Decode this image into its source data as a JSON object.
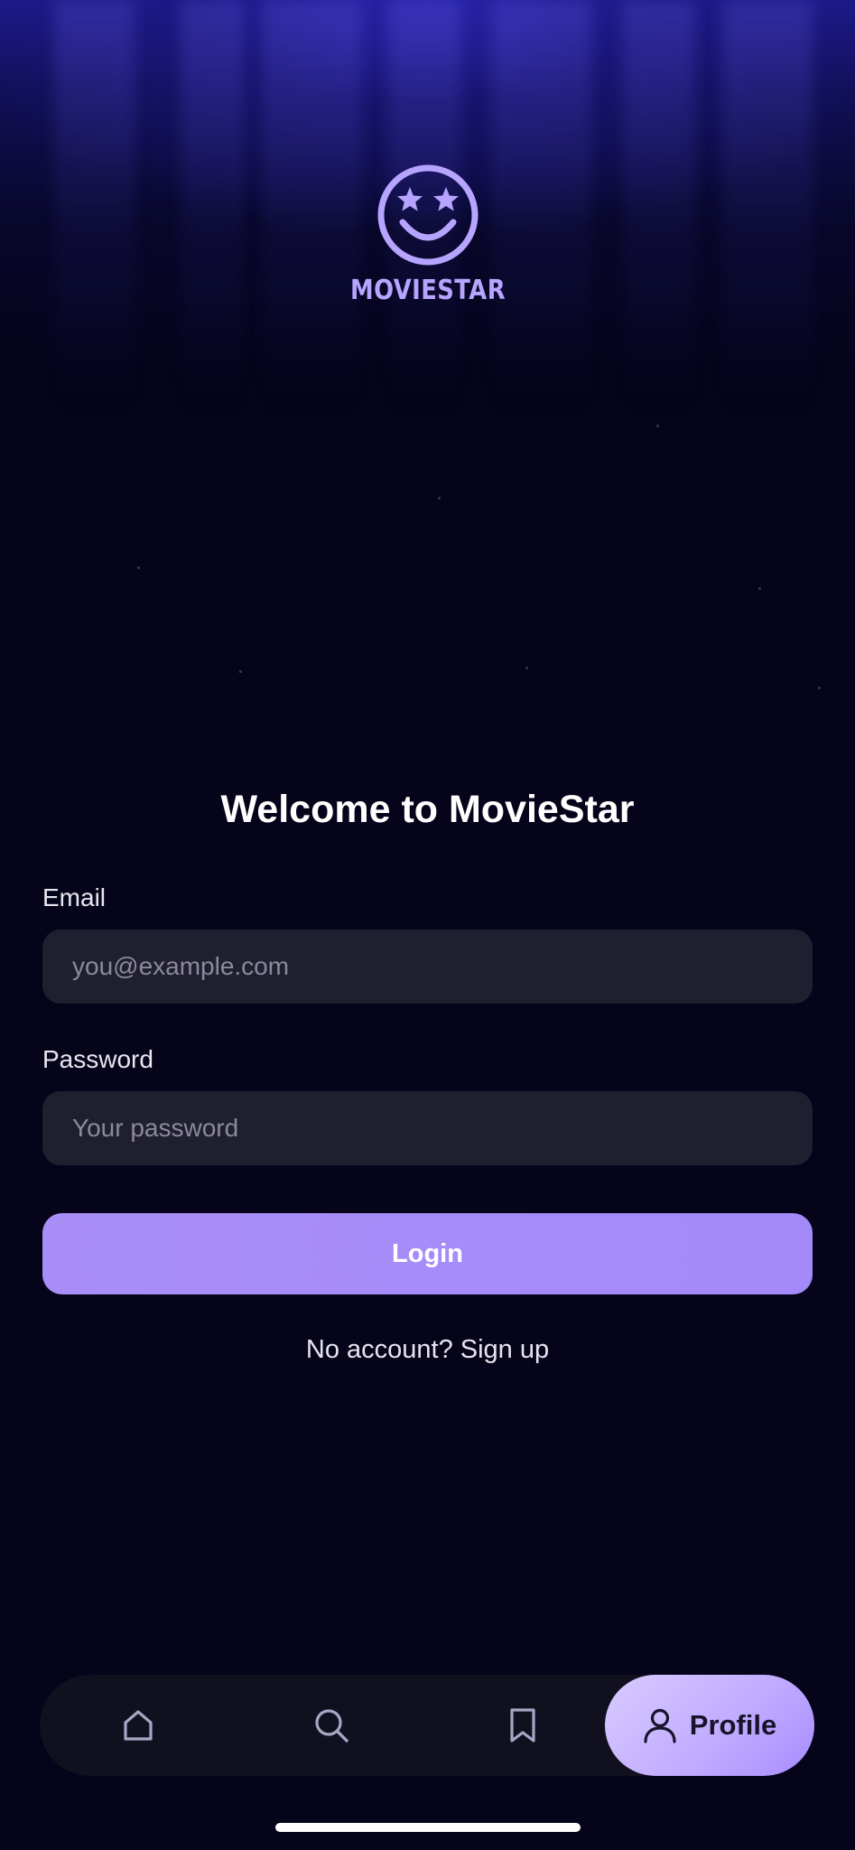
{
  "brand": {
    "logo_text": "MOVIESTAR",
    "accent_color": "#b6a4ff"
  },
  "login": {
    "title": "Welcome to MovieStar",
    "email_label": "Email",
    "email_placeholder": "you@example.com",
    "password_label": "Password",
    "password_placeholder": "Your password",
    "login_button": "Login",
    "signup_prompt": "No account? Sign up"
  },
  "tabbar": {
    "tabs": [
      {
        "icon": "home-icon",
        "label": ""
      },
      {
        "icon": "search-icon",
        "label": ""
      },
      {
        "icon": "bookmark-icon",
        "label": ""
      },
      {
        "icon": "user-icon",
        "label": "Profile",
        "active": true
      }
    ],
    "active_color": "#c7b5ff"
  }
}
